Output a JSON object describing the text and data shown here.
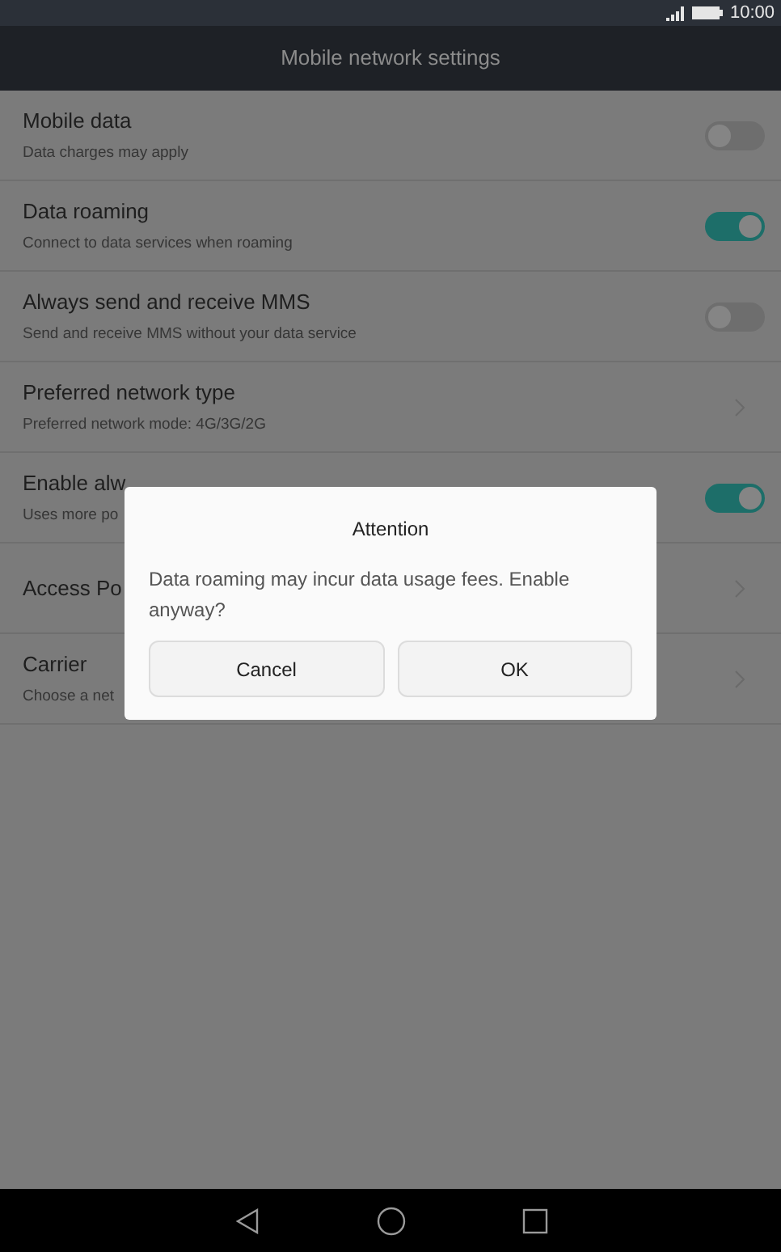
{
  "status_bar": {
    "time": "10:00"
  },
  "header": {
    "title": "Mobile network settings"
  },
  "settings": [
    {
      "kind": "switch",
      "title": "Mobile data",
      "subtitle": "Data charges may apply",
      "on": false
    },
    {
      "kind": "switch",
      "title": "Data roaming",
      "subtitle": "Connect to data services when roaming",
      "on": true
    },
    {
      "kind": "switch",
      "title": "Always send and receive MMS",
      "subtitle": "Send and receive MMS without your data service",
      "on": false
    },
    {
      "kind": "link",
      "title": "Preferred network type",
      "subtitle": "Preferred network mode: 4G/3G/2G"
    },
    {
      "kind": "switch",
      "title": "Enable alw",
      "subtitle": "Uses more po",
      "on": true
    },
    {
      "kind": "link",
      "title": "Access Po"
    },
    {
      "kind": "link",
      "title": "Carrier",
      "subtitle": "Choose a net"
    }
  ],
  "dialog": {
    "title": "Attention",
    "message": "Data roaming may incur data usage fees. Enable anyway?",
    "buttons": [
      "Cancel",
      "OK"
    ]
  }
}
